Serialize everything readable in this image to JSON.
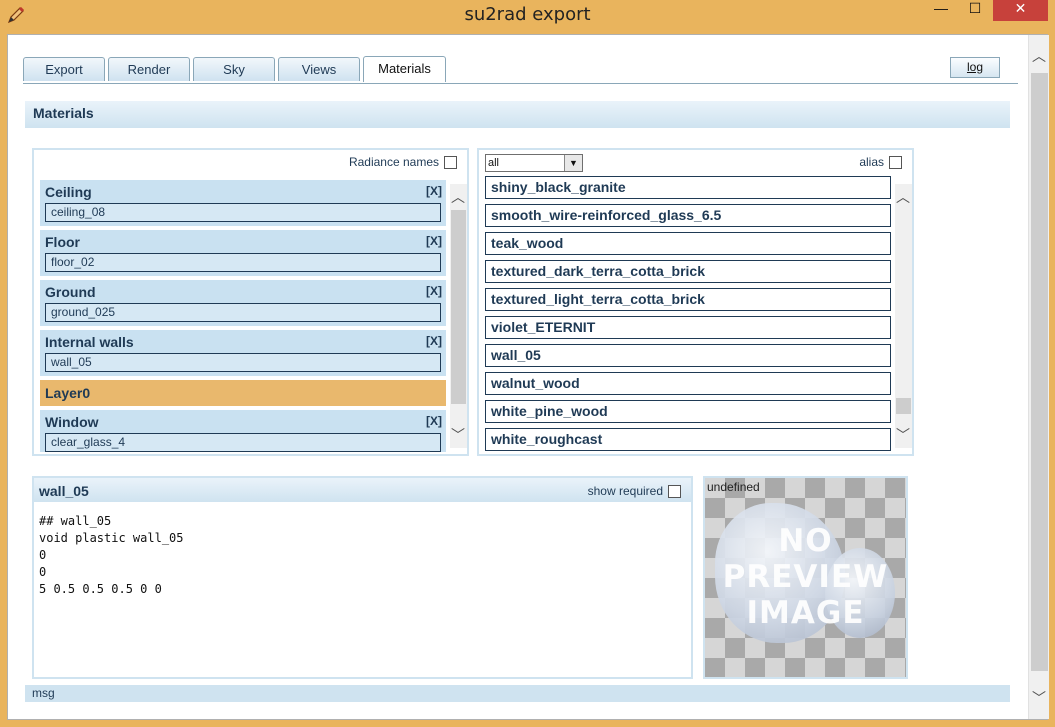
{
  "window": {
    "title": "su2rad export",
    "minimize_glyph": "—",
    "maximize_glyph": "☐",
    "close_glyph": "✕",
    "app_icon": "pencil-icon"
  },
  "tabs": [
    {
      "label": "Export",
      "active": false
    },
    {
      "label": "Render",
      "active": false
    },
    {
      "label": "Sky",
      "active": false
    },
    {
      "label": "Views",
      "active": false
    },
    {
      "label": "Materials",
      "active": true
    }
  ],
  "log_button": "log",
  "section_title": "Materials",
  "layers_panel": {
    "radiance_names_label": "Radiance names",
    "radiance_names_checked": false,
    "remove_label": "[X]",
    "items": [
      {
        "name": "Ceiling",
        "material": "ceiling_08"
      },
      {
        "name": "Floor",
        "material": "floor_02"
      },
      {
        "name": "Ground",
        "material": "ground_025"
      },
      {
        "name": "Internal walls",
        "material": "wall_05"
      },
      {
        "name": "Layer0",
        "material": null,
        "selected": true
      },
      {
        "name": "Window",
        "material": "clear_glass_4"
      }
    ]
  },
  "materials_panel": {
    "filter_value": "all",
    "alias_label": "alias",
    "alias_checked": false,
    "items": [
      "shiny_black_granite",
      "smooth_wire-reinforced_glass_6.5",
      "teak_wood",
      "textured_dark_terra_cotta_brick",
      "textured_light_terra_cotta_brick",
      "violet_ETERNIT",
      "wall_05",
      "walnut_wood",
      "white_pine_wood",
      "white_roughcast"
    ]
  },
  "definition": {
    "title": "wall_05",
    "show_required_label": "show required",
    "show_required_checked": false,
    "lines": [
      "## wall_05",
      "void plastic wall_05",
      "0",
      "0",
      "5 0.5 0.5 0.5 0 0"
    ]
  },
  "preview": {
    "caption": "undefined",
    "placeholder_lines": [
      "NO",
      "PREVIEW",
      "IMAGE"
    ]
  },
  "status": {
    "msg": "msg"
  },
  "colors": {
    "title_bar": "#e9b45d",
    "close_button": "#c7413b",
    "panel_blue": "#c9e1f1",
    "text_blue": "#1f3a55",
    "selected_layer": "#e9b86d"
  }
}
